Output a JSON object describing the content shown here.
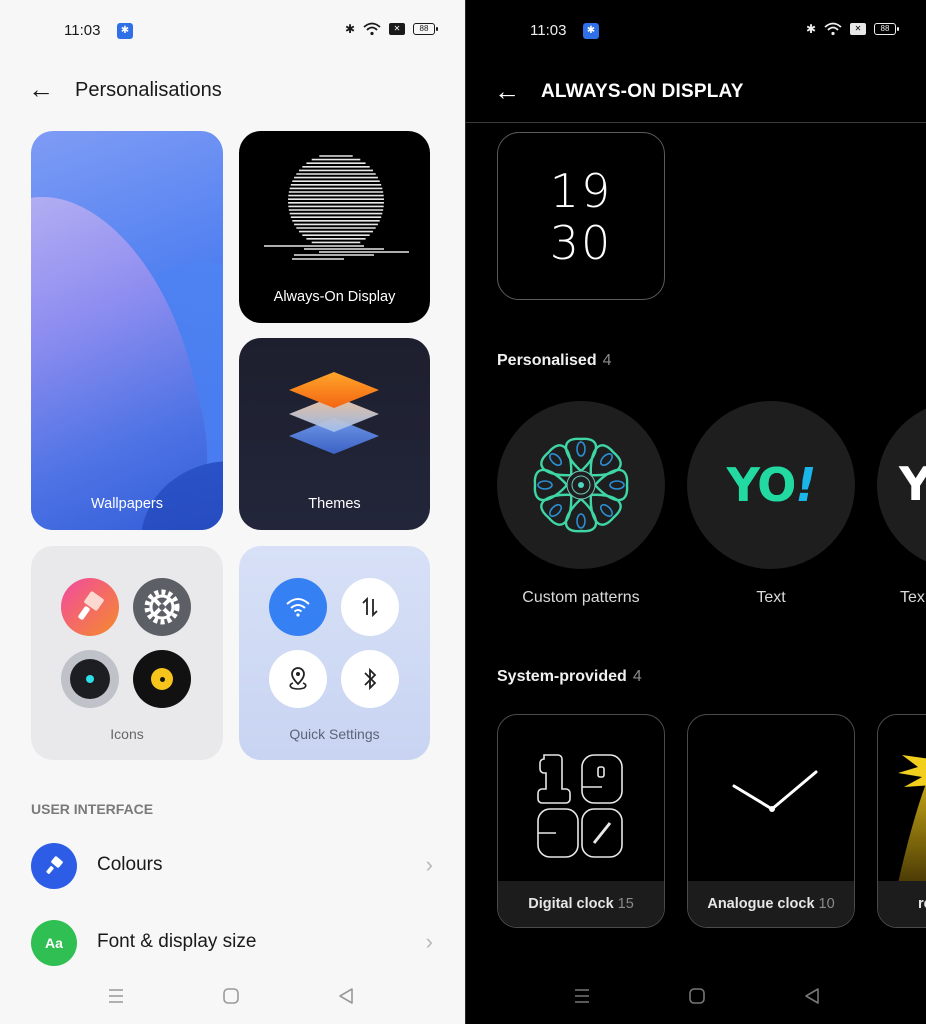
{
  "left": {
    "status": {
      "time": "11:03",
      "battery": "88"
    },
    "header": {
      "title": "Personalisations"
    },
    "tiles": {
      "wallpapers": "Wallpapers",
      "aod": "Always-On Display",
      "themes": "Themes",
      "icons": "Icons",
      "quick_settings": "Quick Settings"
    },
    "section_label": "USER INTERFACE",
    "list": [
      {
        "label": "Colours",
        "icon": "paint-roller-icon",
        "color": "#2d5ce6"
      },
      {
        "label": "Font & display size",
        "icon_text": "Aa",
        "color": "#2fbf52"
      }
    ]
  },
  "right": {
    "status": {
      "time": "11:03",
      "battery": "88"
    },
    "header": {
      "title": "ALWAYS-ON DISPLAY"
    },
    "preview": {
      "hour": "19",
      "minute": "30"
    },
    "personalised": {
      "title": "Personalised",
      "count": "4",
      "items": [
        {
          "label": "Custom patterns"
        },
        {
          "label": "Text",
          "preview_text": "YO",
          "preview_mark": "!"
        },
        {
          "label": "Tex",
          "preview_text": "Y"
        }
      ]
    },
    "system": {
      "title": "System-provided",
      "count": "4",
      "items": [
        {
          "label": "Digital clock",
          "count": "15"
        },
        {
          "label": "Analogue clock",
          "count": "10"
        },
        {
          "label": "re",
          "count": ""
        }
      ]
    }
  },
  "colors": {
    "accent_blue": "#3580f3",
    "status_bt_badge": "#2f6fe8",
    "yo_green": "#22d9a2",
    "yo_blue": "#1ab6ea"
  }
}
